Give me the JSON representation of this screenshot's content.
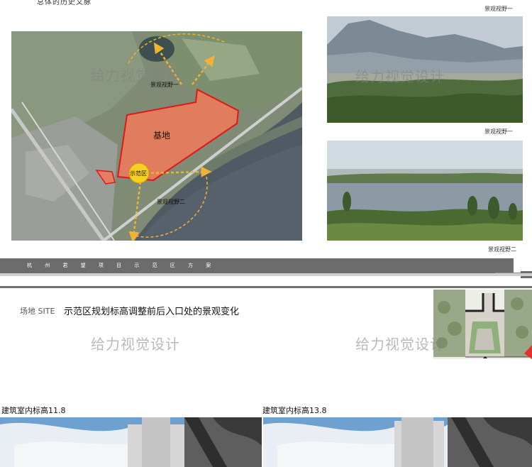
{
  "top_text": "总体的历史文脉",
  "map": {
    "base_label": "基地",
    "demo_label": "示范区",
    "view1_label": "景观视野一",
    "view2_label": "景观视野二"
  },
  "photos": {
    "photo1_caption": "景观视野一",
    "photo2_caption_top": "景观视野一",
    "photo2_caption_bottom": "景观视野二"
  },
  "title_bar": {
    "text": "杭 州 君 望 项 目 示 范 区 方 案"
  },
  "site": {
    "label": "场地 SITE",
    "title": "示范区规划标高调整前后入口处的景观变化"
  },
  "watermark": "给力视觉设计",
  "renders": {
    "left_caption": "建筑室内标高11.8",
    "right_caption": "建筑室内标高13.8"
  },
  "colors": {
    "base_fill": "#f07a5a",
    "base_stroke": "#e01818",
    "arrow": "#f2b233",
    "demo_circle": "#f5d020",
    "bar": "#6c6c6c"
  }
}
